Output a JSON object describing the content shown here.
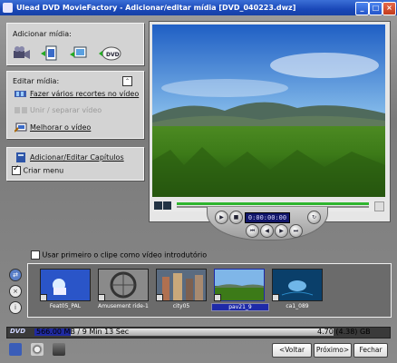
{
  "window": {
    "title": "Ulead DVD MovieFactory - Adicionar/editar mídia [DVD_040223.dwz]",
    "minimize": "_",
    "maximize": "□",
    "close": "×"
  },
  "add_media": {
    "heading": "Adicionar mídia:",
    "icons": [
      "capture-video-icon",
      "insert-video-file-icon",
      "insert-slideshow-icon",
      "import-dvd-icon"
    ]
  },
  "edit_media": {
    "heading": "Editar mídia:",
    "items": [
      {
        "label": "Fazer vários recortes no vídeo",
        "icon": "multi-trim-icon",
        "enabled": true
      },
      {
        "label": "Unir / separar vídeo",
        "icon": "join-split-icon",
        "enabled": false
      },
      {
        "label": "Melhorar o vídeo",
        "icon": "enhance-video-icon",
        "enabled": true
      }
    ]
  },
  "chapters": {
    "label": "Adicionar/Editar Capítulos",
    "create_menu_label": "Criar menu",
    "create_menu_checked": true
  },
  "preview": {
    "timecode": "0:00:00:00"
  },
  "intro_option": {
    "label": "Usar primeiro o clipe como vídeo introdutório",
    "checked": false
  },
  "clips": [
    {
      "name": "Feat05_PAL",
      "selected": false
    },
    {
      "name": "Amusement ride-1",
      "selected": false
    },
    {
      "name": "city05",
      "selected": false
    },
    {
      "name": "pav21_9",
      "selected": true
    },
    {
      "name": "ca1_089",
      "selected": false
    }
  ],
  "capacity": {
    "used": "566.00 MB / 9 Min 13 Sec",
    "total": "4.70 (4.38) GB",
    "used_fraction": 0.12,
    "logo": "DVD"
  },
  "buttons": {
    "back": "<Voltar",
    "next": "Próximo>",
    "close": "Fechar"
  },
  "colors": {
    "titlebar": "#1a48b8",
    "panel": "#d3d3d3",
    "selection": "#1e2aa8"
  }
}
